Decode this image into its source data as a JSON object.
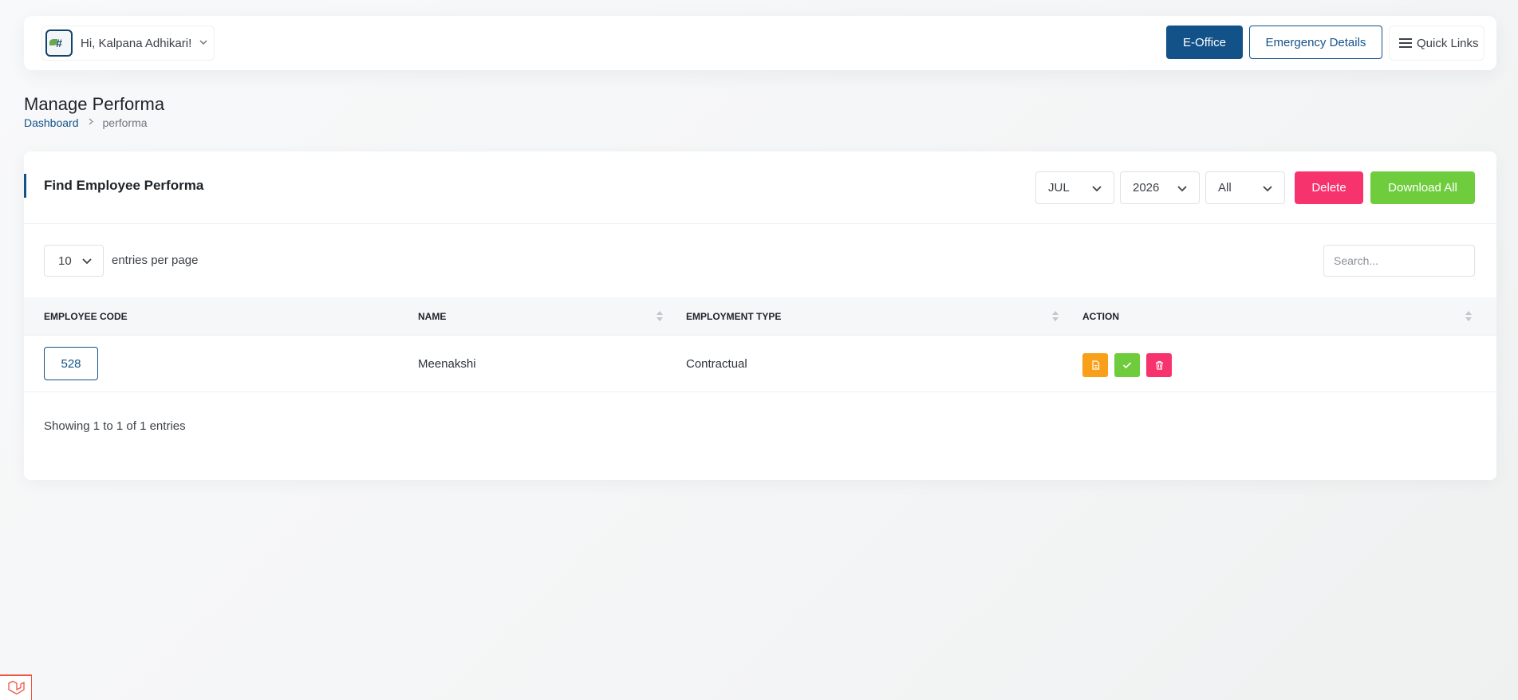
{
  "header": {
    "user_greeting": "Hi, Kalpana Adhikari!",
    "avatar_alt": "#",
    "eoffice_label": "E-Office",
    "emergency_label": "Emergency Details",
    "quicklinks_label": "Quick Links"
  },
  "page": {
    "title": "Manage Performa",
    "breadcrumb": {
      "home": "Dashboard",
      "current": "performa"
    }
  },
  "card": {
    "title": "Find Employee Performa",
    "filters": {
      "month": "JUL",
      "year": "2026",
      "type": "All"
    },
    "delete_label": "Delete",
    "download_label": "Download All"
  },
  "table_controls": {
    "per_page": "10",
    "per_page_label": "entries per page",
    "search_placeholder": "Search..."
  },
  "table": {
    "columns": [
      "EMPLOYEE CODE",
      "NAME",
      "EMPLOYMENT TYPE",
      "ACTION"
    ],
    "rows": [
      {
        "code": "528",
        "name": "Meenakshi",
        "type": "Contractual"
      }
    ]
  },
  "footer": {
    "showing": "Showing 1 to 1 of 1 entries"
  },
  "colors": {
    "primary": "#135289",
    "danger": "#f7336e",
    "success": "#6fcd3d",
    "warning": "#f9a01b"
  },
  "icons": {
    "quicklinks": "list-icon",
    "action_view": "file-icon",
    "action_approve": "check-icon",
    "action_delete": "trash-icon",
    "dev_toolbar": "laravel-logo-icon"
  }
}
